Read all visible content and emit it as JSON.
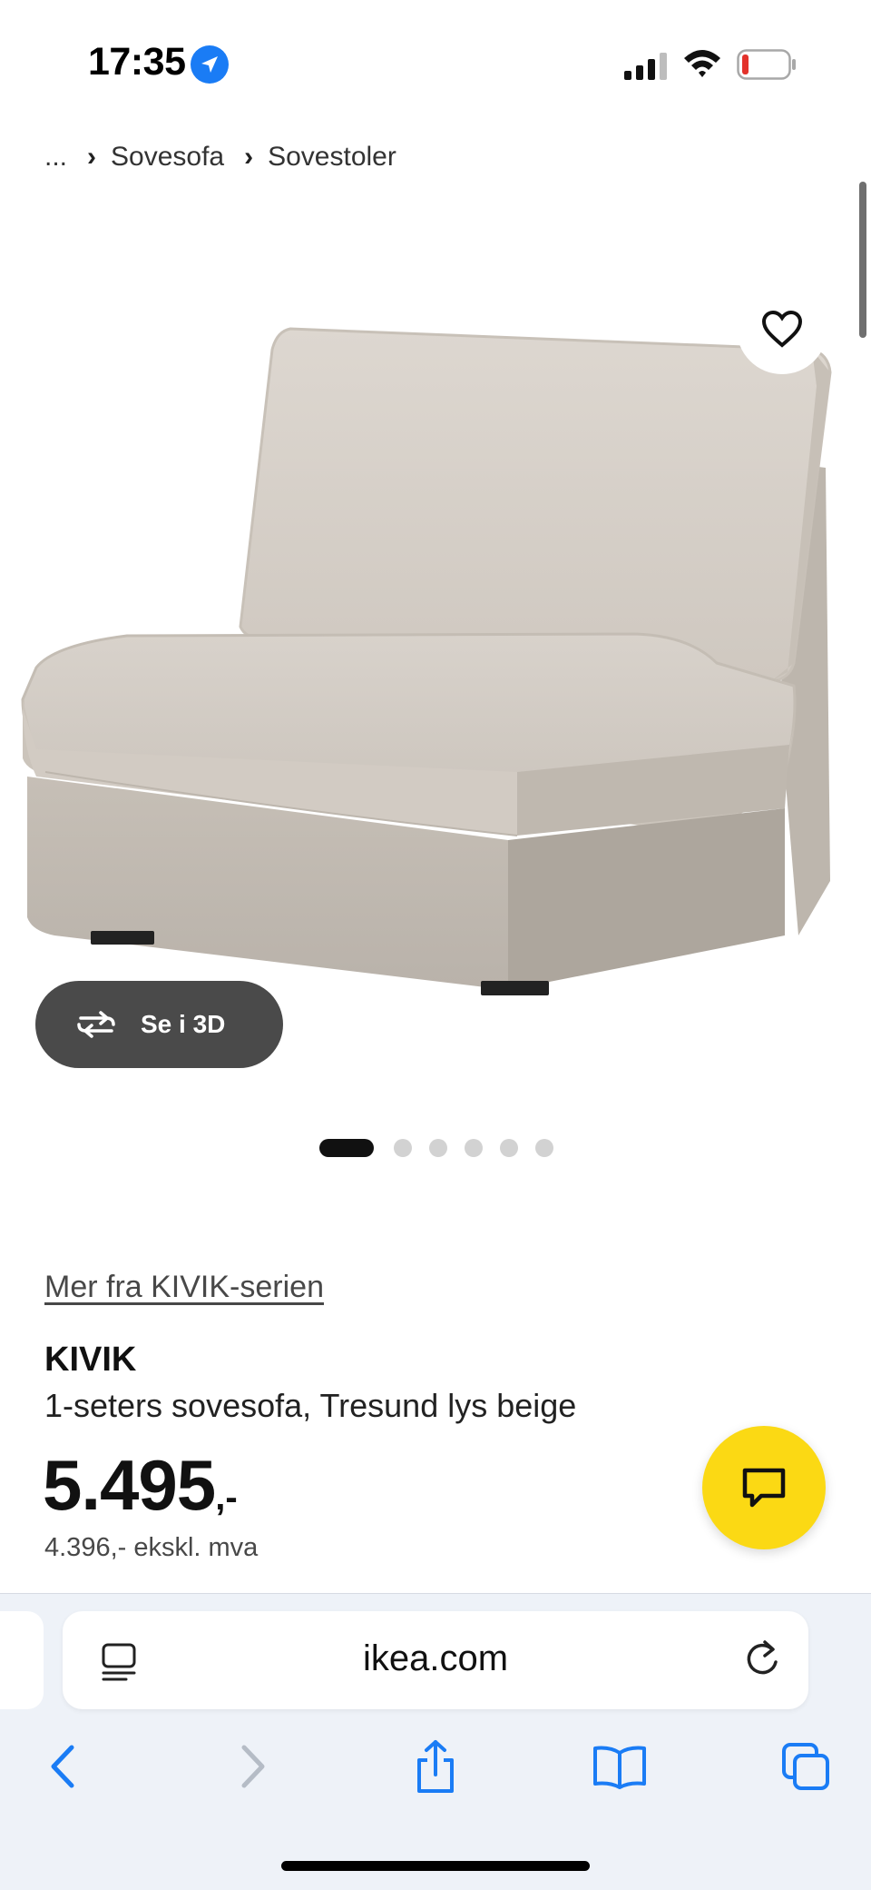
{
  "status_bar": {
    "time": "17:35",
    "icons": [
      "location-arrow-icon",
      "cellular-signal-icon",
      "wifi-icon",
      "battery-low-icon"
    ]
  },
  "breadcrumb": {
    "items": [
      "...",
      "Sovesofa",
      "Sovestoler"
    ]
  },
  "product_image": {
    "icon": "armchair-sofa-bed-photo",
    "view_3d_label": "Se i 3D",
    "carousel": {
      "total": 6,
      "active_index": 0
    }
  },
  "product": {
    "series_link": "Mer fra KIVIK-serien",
    "name": "KIVIK",
    "description": "1-seters sovesofa, Tresund lys beige",
    "price_main": "5.495",
    "price_suffix": ",-",
    "price_ex_vat": "4.396,- ekskl. mva"
  },
  "chat": {
    "icon": "chat-bubble-icon"
  },
  "browser": {
    "url": "ikea.com",
    "toolbar_icons": [
      "back-icon",
      "forward-icon",
      "share-icon",
      "bookmarks-icon",
      "tabs-icon"
    ]
  },
  "colors": {
    "accent_yellow": "#fbd914",
    "safari_blue": "#1a7cf5",
    "dark_pill": "#4a4a4a",
    "battery_red": "#e3322b"
  }
}
